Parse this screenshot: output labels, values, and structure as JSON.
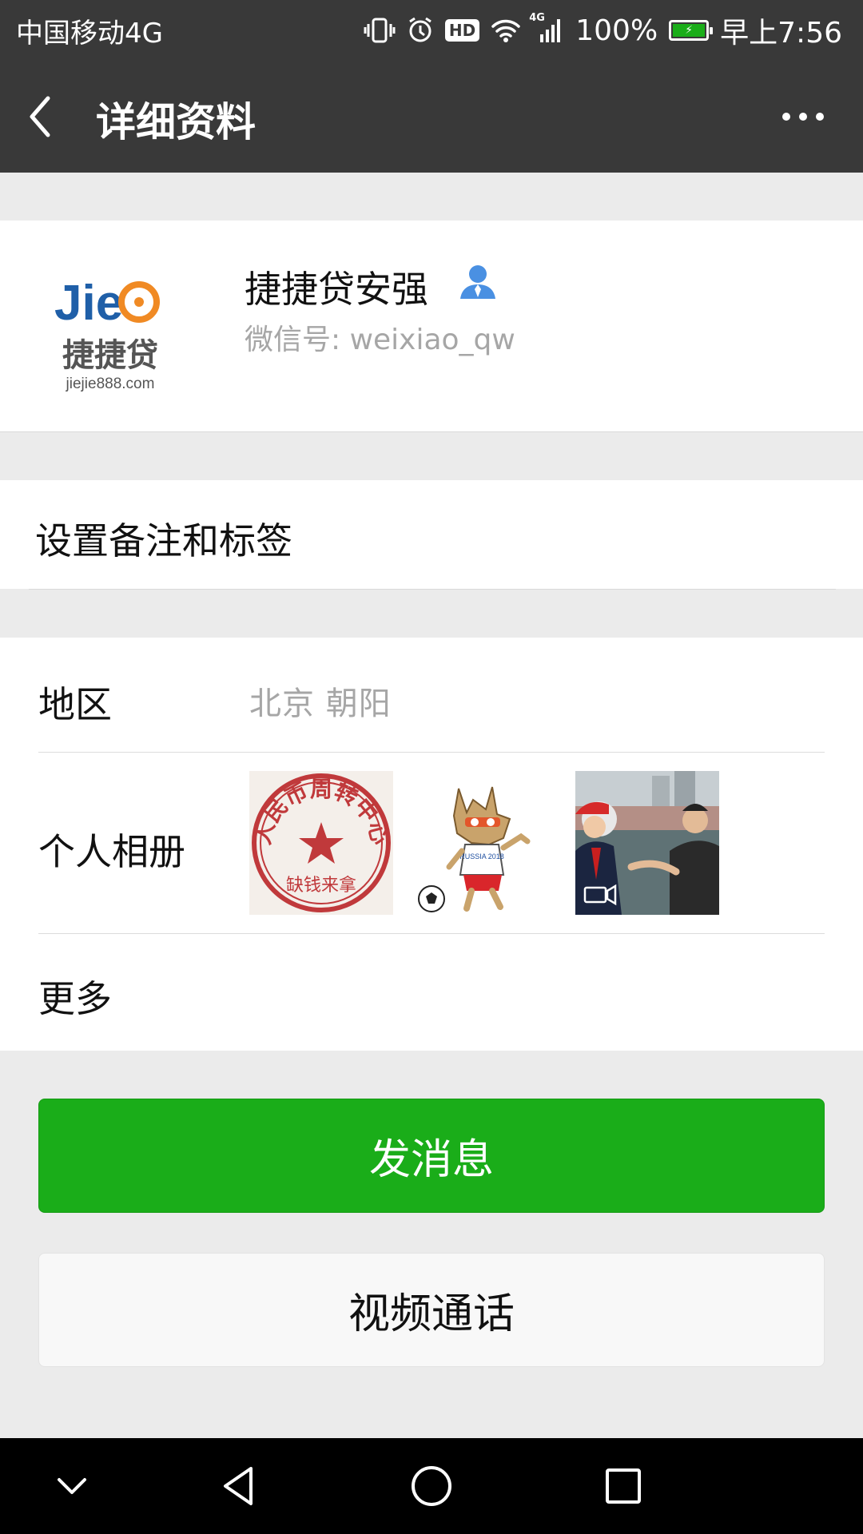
{
  "status_bar": {
    "carrier": "中国移动4G",
    "signal_type": "4G",
    "battery": "100%",
    "time": "早上7:56",
    "hd_label": "HD",
    "icons": [
      "vibrate-icon",
      "alarm-icon",
      "hd-icon",
      "wifi-icon",
      "signal-icon",
      "battery-icon"
    ]
  },
  "nav": {
    "title": "详细资料",
    "back_icon": "chevron-left-icon",
    "more_icon": "ellipsis-icon"
  },
  "profile": {
    "name": "捷捷贷安强",
    "wechat_id": "微信号: weixiao_qw",
    "avatar": {
      "logo_text": "Jie",
      "brand": "捷捷贷",
      "domain": "jiejie888.com"
    }
  },
  "remark": {
    "label": "设置备注和标签"
  },
  "info": {
    "region_label": "地区",
    "region_value": "北京  朝阳",
    "album_label": "个人相册",
    "more_label": "更多",
    "album_thumbs": [
      {
        "kind": "stamp",
        "ring_text": "人民币周转中心",
        "inner_text": "缺钱来拿"
      },
      {
        "kind": "mascot",
        "shirt_text": "RUSSIA 2018"
      },
      {
        "kind": "video",
        "icon": "video-camera-icon"
      }
    ]
  },
  "actions": {
    "send_message": "发消息",
    "video_call": "视频通话"
  },
  "colors": {
    "header": "#393939",
    "background": "#ebebeb",
    "primary_green": "#1aad19",
    "secondary_text": "#a6a6a6",
    "contact_icon_blue": "#4a90e2"
  }
}
